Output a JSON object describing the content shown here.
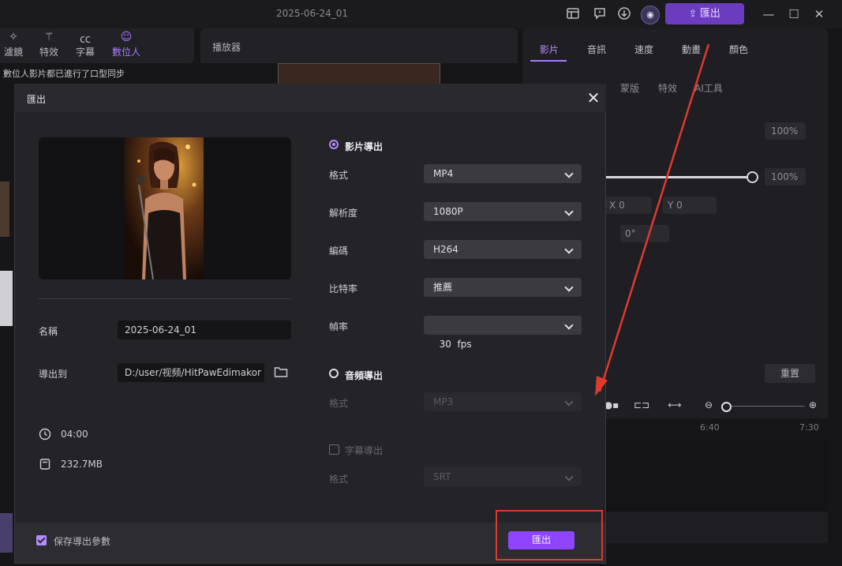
{
  "app": {
    "doc_title": "2025-06-24_01",
    "top_export_label": "匯出"
  },
  "left_panel": {
    "tabs": [
      {
        "label": "濾鏡",
        "icon": "sparkle-icon"
      },
      {
        "label": "特效",
        "icon": "magic-wand-icon"
      },
      {
        "label": "字幕",
        "icon": "caption-icon"
      },
      {
        "label": "數位人",
        "icon": "digital-human-icon",
        "active": true
      }
    ],
    "notice": "數位人影片都已進行了口型同步"
  },
  "player": {
    "title": "播放器"
  },
  "right_panel": {
    "tabs": [
      {
        "label": "影片",
        "active": true
      },
      {
        "label": "音訊"
      },
      {
        "label": "速度"
      },
      {
        "label": "動畫"
      },
      {
        "label": "顏色"
      }
    ],
    "subtabs": [
      "蒙版",
      "特效",
      "AI工具"
    ],
    "scale_value": "100%",
    "opacity_value": "100%",
    "pos_x_label": "X",
    "pos_x_value": "0",
    "pos_y_label": "Y",
    "pos_y_value": "0",
    "rotation_value": "0°",
    "reset_label": "重置"
  },
  "timeline": {
    "ticks": [
      "6:40",
      "7:30"
    ],
    "zoom_level": 0.0
  },
  "dialog": {
    "title": "匯出",
    "name_label": "名稱",
    "name_value": "2025-06-24_01",
    "export_to_label": "導出到",
    "export_path": "D:/user/视频/HitPawEdimakor",
    "duration": "04:00",
    "file_size": "232.7MB",
    "video_export": {
      "title": "影片導出",
      "format_label": "格式",
      "format_value": "MP4",
      "resolution_label": "解析度",
      "resolution_value": "1080P",
      "codec_label": "編碼",
      "codec_value": "H264",
      "bitrate_label": "比特率",
      "bitrate_value": "推薦",
      "framerate_label": "幀率",
      "framerate_value": "30  fps"
    },
    "audio_export": {
      "title": "音頻導出",
      "format_label": "格式",
      "format_value": "MP3"
    },
    "subtitle_export": {
      "title": "字幕導出",
      "format_label": "格式",
      "format_value": "SRT"
    },
    "save_params_label": "保存導出參數",
    "export_button": "匯出"
  },
  "colors": {
    "accent": "#8f45ff",
    "annotation": "#e0392e"
  }
}
